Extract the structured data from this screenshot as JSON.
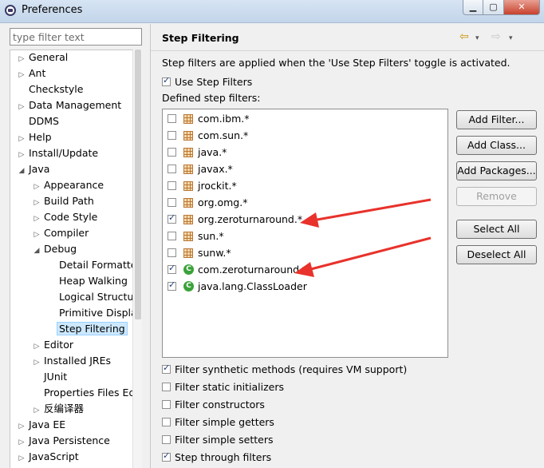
{
  "window": {
    "title": "Preferences",
    "minimize": "▁",
    "maximize": "▢",
    "close": "✕"
  },
  "filter": {
    "placeholder": "type filter text",
    "value": ""
  },
  "tree": {
    "items": [
      {
        "label": "General",
        "expander": "▷"
      },
      {
        "label": "Ant",
        "expander": "▷"
      },
      {
        "label": "Checkstyle",
        "expander": ""
      },
      {
        "label": "Data Management",
        "expander": "▷"
      },
      {
        "label": "DDMS",
        "expander": ""
      },
      {
        "label": "Help",
        "expander": "▷"
      },
      {
        "label": "Install/Update",
        "expander": "▷"
      },
      {
        "label": "Java",
        "expander": "◢"
      },
      {
        "label": "Appearance",
        "expander": "▷"
      },
      {
        "label": "Build Path",
        "expander": "▷"
      },
      {
        "label": "Code Style",
        "expander": "▷"
      },
      {
        "label": "Compiler",
        "expander": "▷"
      },
      {
        "label": "Debug",
        "expander": "◢"
      },
      {
        "label": "Detail Formatte",
        "expander": ""
      },
      {
        "label": "Heap Walking",
        "expander": ""
      },
      {
        "label": "Logical Structur",
        "expander": ""
      },
      {
        "label": "Primitive Displa",
        "expander": ""
      },
      {
        "label": "Step Filtering",
        "expander": ""
      },
      {
        "label": "Editor",
        "expander": "▷"
      },
      {
        "label": "Installed JREs",
        "expander": "▷"
      },
      {
        "label": "JUnit",
        "expander": ""
      },
      {
        "label": "Properties Files Ed",
        "expander": ""
      },
      {
        "label": "反编译器",
        "expander": "▷"
      },
      {
        "label": "Java EE",
        "expander": "▷"
      },
      {
        "label": "Java Persistence",
        "expander": "▷"
      },
      {
        "label": "JavaScript",
        "expander": "▷"
      }
    ],
    "selected": "Step Filtering"
  },
  "page": {
    "title": "Step Filtering",
    "nav": {
      "back": "⇦",
      "forward": "⇨",
      "menu": "▾"
    },
    "description": "Step filters are applied when the 'Use Step Filters' toggle is activated.",
    "use_step_filters": {
      "label": "Use Step Filters",
      "checked": true
    },
    "defined_label": "Defined step filters:",
    "filters": [
      {
        "name": "com.ibm.*",
        "checked": false,
        "icon": "package-icon"
      },
      {
        "name": "com.sun.*",
        "checked": false,
        "icon": "package-icon"
      },
      {
        "name": "java.*",
        "checked": false,
        "icon": "package-icon"
      },
      {
        "name": "javax.*",
        "checked": false,
        "icon": "package-icon"
      },
      {
        "name": "jrockit.*",
        "checked": false,
        "icon": "package-icon"
      },
      {
        "name": "org.omg.*",
        "checked": false,
        "icon": "package-icon"
      },
      {
        "name": "org.zeroturnaround.*",
        "checked": true,
        "icon": "package-icon"
      },
      {
        "name": "sun.*",
        "checked": false,
        "icon": "package-icon"
      },
      {
        "name": "sunw.*",
        "checked": false,
        "icon": "package-icon"
      },
      {
        "name": "com.zeroturnaround.*",
        "checked": true,
        "icon": "class-icon"
      },
      {
        "name": "java.lang.ClassLoader",
        "checked": true,
        "icon": "class-icon"
      }
    ],
    "buttons": {
      "add_filter": "Add Filter...",
      "add_class": "Add Class...",
      "add_packages": "Add Packages...",
      "remove": "Remove",
      "select_all": "Select All",
      "deselect_all": "Deselect All"
    },
    "options": [
      {
        "label": "Filter synthetic methods (requires VM support)",
        "checked": true
      },
      {
        "label": "Filter static initializers",
        "checked": false
      },
      {
        "label": "Filter constructors",
        "checked": false
      },
      {
        "label": "Filter simple getters",
        "checked": false
      },
      {
        "label": "Filter simple setters",
        "checked": false
      },
      {
        "label": "Step through filters",
        "checked": true
      }
    ]
  },
  "colors": {
    "arrow": "#e8322b",
    "class_icon": "#3aa23a",
    "selection": "#cce8ff"
  }
}
